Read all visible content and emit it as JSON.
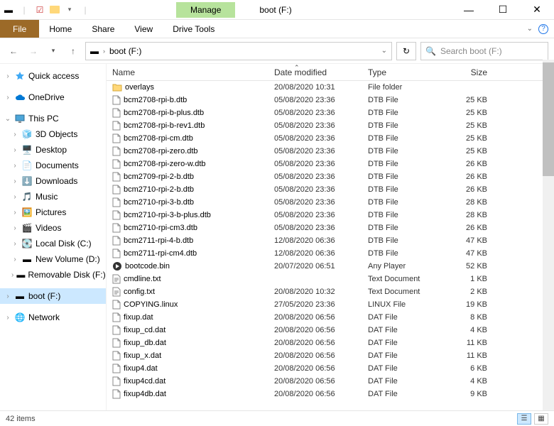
{
  "window": {
    "title": "boot (F:)",
    "manage_label": "Manage",
    "drive_tools_label": "Drive Tools"
  },
  "menu": {
    "file": "File",
    "home": "Home",
    "share": "Share",
    "view": "View"
  },
  "address_bar": {
    "path": "boot (F:)"
  },
  "search": {
    "placeholder": "Search boot (F:)"
  },
  "columns": {
    "name": "Name",
    "date": "Date modified",
    "type": "Type",
    "size": "Size"
  },
  "sidebar": {
    "quick_access": "Quick access",
    "onedrive": "OneDrive",
    "this_pc": "This PC",
    "objects3d": "3D Objects",
    "desktop": "Desktop",
    "documents": "Documents",
    "downloads": "Downloads",
    "music": "Music",
    "pictures": "Pictures",
    "videos": "Videos",
    "local_disk": "Local Disk (C:)",
    "new_volume": "New Volume (D:)",
    "removable": "Removable Disk (F:)",
    "boot": "boot (F:)",
    "network": "Network"
  },
  "files": [
    {
      "icon": "folder",
      "name": "overlays",
      "date": "20/08/2020 10:31",
      "type": "File folder",
      "size": ""
    },
    {
      "icon": "file",
      "name": "bcm2708-rpi-b.dtb",
      "date": "05/08/2020 23:36",
      "type": "DTB File",
      "size": "25 KB"
    },
    {
      "icon": "file",
      "name": "bcm2708-rpi-b-plus.dtb",
      "date": "05/08/2020 23:36",
      "type": "DTB File",
      "size": "25 KB"
    },
    {
      "icon": "file",
      "name": "bcm2708-rpi-b-rev1.dtb",
      "date": "05/08/2020 23:36",
      "type": "DTB File",
      "size": "25 KB"
    },
    {
      "icon": "file",
      "name": "bcm2708-rpi-cm.dtb",
      "date": "05/08/2020 23:36",
      "type": "DTB File",
      "size": "25 KB"
    },
    {
      "icon": "file",
      "name": "bcm2708-rpi-zero.dtb",
      "date": "05/08/2020 23:36",
      "type": "DTB File",
      "size": "25 KB"
    },
    {
      "icon": "file",
      "name": "bcm2708-rpi-zero-w.dtb",
      "date": "05/08/2020 23:36",
      "type": "DTB File",
      "size": "26 KB"
    },
    {
      "icon": "file",
      "name": "bcm2709-rpi-2-b.dtb",
      "date": "05/08/2020 23:36",
      "type": "DTB File",
      "size": "26 KB"
    },
    {
      "icon": "file",
      "name": "bcm2710-rpi-2-b.dtb",
      "date": "05/08/2020 23:36",
      "type": "DTB File",
      "size": "26 KB"
    },
    {
      "icon": "file",
      "name": "bcm2710-rpi-3-b.dtb",
      "date": "05/08/2020 23:36",
      "type": "DTB File",
      "size": "28 KB"
    },
    {
      "icon": "file",
      "name": "bcm2710-rpi-3-b-plus.dtb",
      "date": "05/08/2020 23:36",
      "type": "DTB File",
      "size": "28 KB"
    },
    {
      "icon": "file",
      "name": "bcm2710-rpi-cm3.dtb",
      "date": "05/08/2020 23:36",
      "type": "DTB File",
      "size": "26 KB"
    },
    {
      "icon": "file",
      "name": "bcm2711-rpi-4-b.dtb",
      "date": "12/08/2020 06:36",
      "type": "DTB File",
      "size": "47 KB"
    },
    {
      "icon": "file",
      "name": "bcm2711-rpi-cm4.dtb",
      "date": "12/08/2020 06:36",
      "type": "DTB File",
      "size": "47 KB"
    },
    {
      "icon": "media",
      "name": "bootcode.bin",
      "date": "20/07/2020 06:51",
      "type": "Any Player",
      "size": "52 KB"
    },
    {
      "icon": "text",
      "name": "cmdline.txt",
      "date": "",
      "type": "Text Document",
      "size": "1 KB"
    },
    {
      "icon": "text",
      "name": "config.txt",
      "date": "20/08/2020 10:32",
      "type": "Text Document",
      "size": "2 KB"
    },
    {
      "icon": "file",
      "name": "COPYING.linux",
      "date": "27/05/2020 23:36",
      "type": "LINUX File",
      "size": "19 KB"
    },
    {
      "icon": "file",
      "name": "fixup.dat",
      "date": "20/08/2020 06:56",
      "type": "DAT File",
      "size": "8 KB"
    },
    {
      "icon": "file",
      "name": "fixup_cd.dat",
      "date": "20/08/2020 06:56",
      "type": "DAT File",
      "size": "4 KB"
    },
    {
      "icon": "file",
      "name": "fixup_db.dat",
      "date": "20/08/2020 06:56",
      "type": "DAT File",
      "size": "11 KB"
    },
    {
      "icon": "file",
      "name": "fixup_x.dat",
      "date": "20/08/2020 06:56",
      "type": "DAT File",
      "size": "11 KB"
    },
    {
      "icon": "file",
      "name": "fixup4.dat",
      "date": "20/08/2020 06:56",
      "type": "DAT File",
      "size": "6 KB"
    },
    {
      "icon": "file",
      "name": "fixup4cd.dat",
      "date": "20/08/2020 06:56",
      "type": "DAT File",
      "size": "4 KB"
    },
    {
      "icon": "file",
      "name": "fixup4db.dat",
      "date": "20/08/2020 06:56",
      "type": "DAT File",
      "size": "9 KB"
    }
  ],
  "status": {
    "count": "42 items"
  }
}
